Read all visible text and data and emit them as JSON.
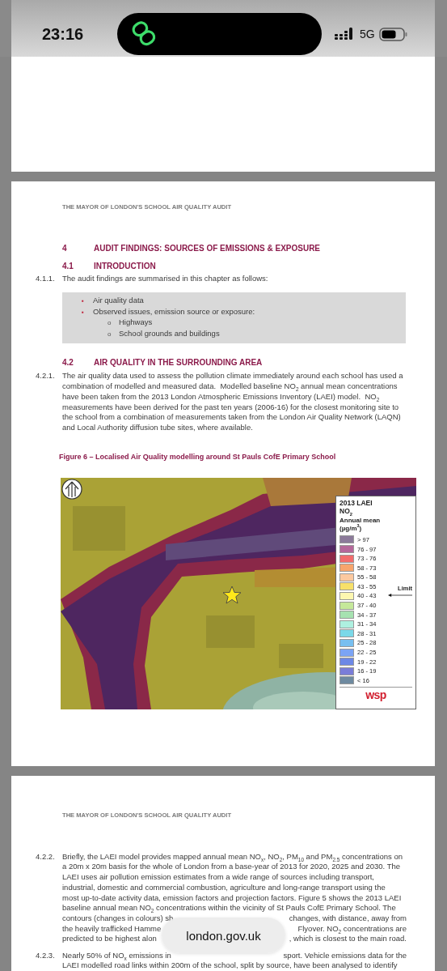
{
  "status_bar": {
    "time": "23:16",
    "network": "5G"
  },
  "report_page_1": {
    "running_header": "THE MAYOR OF LONDON'S SCHOOL AIR QUALITY AUDIT",
    "chapter": {
      "number": "4",
      "title": "AUDIT FINDINGS: SOURCES OF EMISSIONS & EXPOSURE"
    },
    "section_1": {
      "number": "4.1",
      "title": "INTRODUCTION"
    },
    "paragraph_1": {
      "number": "4.1.1.",
      "lines": [
        "The audit findings are summarised in this chapter as follows:"
      ]
    },
    "summary_box": {
      "items": [
        {
          "marker": "▪",
          "text": "Air quality data"
        },
        {
          "marker": "▪",
          "text": "Observed issues, emission source or exposure:",
          "children": [
            {
              "marker": "o",
              "text": "Highways"
            },
            {
              "marker": "o",
              "text": "School grounds and buildings"
            }
          ]
        }
      ]
    },
    "section_2": {
      "number": "4.2",
      "title": "AIR QUALITY IN THE SURROUNDING AREA"
    },
    "paragraph_2": {
      "number": "4.2.1.",
      "lines": [
        "The air quality data used to assess the pollution climate immediately around each school has used a",
        "combination of modelled and measured data.  Modelled baseline NO$_{2}$ annual mean concentrations",
        "have been taken from the 2013 London Atmospheric Emissions Inventory (LAEI) model.  NO$_{2}$",
        "measurements have been derived for the past ten years (2006-16) for the closest monitoring site to",
        "the school from a combination of measurements taken from the London Air Quality Network (LAQN)",
        "and Local Authority diffusion tube sites, where available."
      ]
    },
    "figure": {
      "caption": "Figure 6 – Localised Air Quality modelling around St Pauls  CofE Primary School",
      "legend": {
        "title_lines": [
          "2013 LAEI",
          "NO$_{2}$"
        ],
        "subtitle_lines": [
          "Annual mean",
          "(µg/m$^{3}$)"
        ],
        "limit_label": "Limit",
        "logo": "wsp",
        "items": [
          {
            "label": "> 97",
            "color": "#8c7a9a",
            "limit": false
          },
          {
            "label": "76 - 97",
            "color": "#b5679a",
            "limit": false
          },
          {
            "label": "73 - 76",
            "color": "#f26c6c",
            "limit": false
          },
          {
            "label": "58 - 73",
            "color": "#f7a56c",
            "limit": false
          },
          {
            "label": "55 - 58",
            "color": "#fcc9a0",
            "limit": false
          },
          {
            "label": "43 - 55",
            "color": "#f7e06a",
            "limit": false
          },
          {
            "label": "40 - 43",
            "color": "#fdf7b0",
            "limit": true
          },
          {
            "label": "37 - 40",
            "color": "#c5e89a",
            "limit": false
          },
          {
            "label": "34 - 37",
            "color": "#a6e2b0",
            "limit": false
          },
          {
            "label": "31 - 34",
            "color": "#aef0e0",
            "limit": false
          },
          {
            "label": "28 - 31",
            "color": "#7ad8e8",
            "limit": false
          },
          {
            "label": "25 - 28",
            "color": "#78bff0",
            "limit": false
          },
          {
            "label": "22 - 25",
            "color": "#7ba4f5",
            "limit": false
          },
          {
            "label": "19 - 22",
            "color": "#6d88e6",
            "limit": false
          },
          {
            "label": "16 - 19",
            "color": "#7a7dd8",
            "limit": false
          },
          {
            "label": "< 16",
            "color": "#6e8aa0",
            "limit": false
          }
        ]
      }
    }
  },
  "report_page_2": {
    "running_header": "THE MAYOR OF LONDON'S SCHOOL AIR QUALITY AUDIT",
    "paragraph_3": {
      "number": "4.2.2.",
      "lines": [
        "Briefly, the LAEI model provides mapped annual mean NO$_{x}$, NO$_{2}$, PM$_{10}$ and PM$_{2.5}$ concentrations on",
        "a 20m x 20m basis for the whole of London from a base-year of 2013 for 2020, 2025 and 2030. The",
        "LAEI uses air pollution emission estimates from a wide range of sources including transport,",
        "industrial, domestic and commercial combustion, agriculture and long-range transport using the",
        "most up-to-date activity data, emission factors and projection factors. Figure 5 shows the 2013 LAEI",
        "baseline annual mean NO$_{2}$ concentrations within the vicinity of St Pauls CofE Primary School. The"
      ],
      "covered_lines": [
        {
          "left": "contours (changes in colours) sh",
          "right": "changes, with distance, away from"
        },
        {
          "left": "the heavily trafficked Hamme",
          "right": "Flyover. NO$_{2}$ concentrations are"
        },
        {
          "left": "predicted to be highest alon",
          "right": ", which is closest to the main road."
        }
      ]
    },
    "paragraph_4": {
      "number": "4.2.3.",
      "covered_lines": [
        {
          "left": "Nearly 50% of NO$_{x}$ emissions in",
          "right": "sport. Vehicle emissions data for the"
        }
      ],
      "lines": [
        "LAEI modelled road links within 200m of the school, split by source, have been analysed to identify"
      ]
    }
  },
  "address_bar": {
    "url": "london.gov.uk"
  }
}
